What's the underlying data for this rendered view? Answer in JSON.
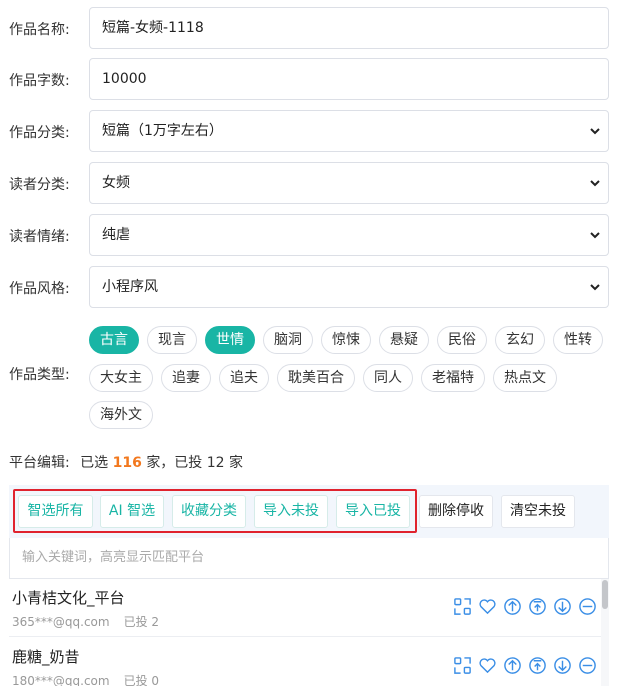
{
  "form": {
    "name_label": "作品名称:",
    "name_value": "短篇-女频-1118",
    "words_label": "作品字数:",
    "words_value": "10000",
    "category_label": "作品分类:",
    "category_value": "短篇（1万字左右）",
    "reader_label": "读者分类:",
    "reader_value": "女频",
    "emotion_label": "读者情绪:",
    "emotion_value": "纯虐",
    "style_label": "作品风格:",
    "style_value": "小程序风",
    "type_label": "作品类型:"
  },
  "tags": [
    {
      "label": "古言",
      "selected": true
    },
    {
      "label": "现言",
      "selected": false
    },
    {
      "label": "世情",
      "selected": true
    },
    {
      "label": "脑洞",
      "selected": false
    },
    {
      "label": "惊悚",
      "selected": false
    },
    {
      "label": "悬疑",
      "selected": false
    },
    {
      "label": "民俗",
      "selected": false
    },
    {
      "label": "玄幻",
      "selected": false
    },
    {
      "label": "性转",
      "selected": false
    },
    {
      "label": "大女主",
      "selected": false
    },
    {
      "label": "追妻",
      "selected": false
    },
    {
      "label": "追夫",
      "selected": false
    },
    {
      "label": "耽美百合",
      "selected": false
    },
    {
      "label": "同人",
      "selected": false
    },
    {
      "label": "老福特",
      "selected": false
    },
    {
      "label": "热点文",
      "selected": false
    },
    {
      "label": "海外文",
      "selected": false
    }
  ],
  "platform": {
    "label": "平台编辑:",
    "selected_prefix": "已选",
    "selected_count": "116",
    "selected_suffix": "家，已投 12 家"
  },
  "toolbar": {
    "select_all": "智选所有",
    "ai_select": "AI 智选",
    "fav_category": "收藏分类",
    "import_unsubmitted": "导入未投",
    "import_submitted": "导入已投",
    "delete_stopped": "删除停收",
    "clear_unsubmitted": "清空未投"
  },
  "search": {
    "placeholder": "输入关键词，高亮显示匹配平台"
  },
  "platforms": [
    {
      "name": "小青桔文化_平台",
      "email": "365***@qq.com",
      "status": "已投 2"
    },
    {
      "name": "鹿糖_奶昔",
      "email": "180***@qq.com",
      "status": "已投 0"
    }
  ],
  "row_icons": [
    "qrcode-icon",
    "heart-icon",
    "arrow-up-icon",
    "arrow-top-icon",
    "arrow-down-icon",
    "minus-icon"
  ],
  "colors": {
    "accent": "#19b5a5",
    "highlight_count": "#f2781e",
    "outline": "#e0232e",
    "icon_blue": "#3a8ee6"
  }
}
